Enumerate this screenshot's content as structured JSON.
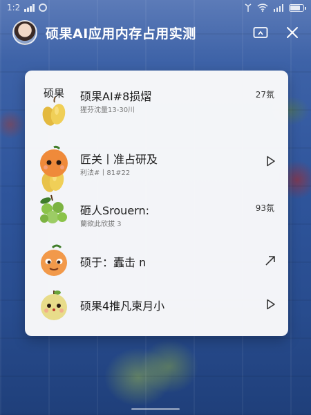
{
  "status_bar": {
    "time": "1:2",
    "signal_icon": "signal-icon",
    "wifi_icon": "wifi-icon",
    "battery_icon": "battery-icon"
  },
  "header": {
    "title": "硕果AI应用内存占用实测",
    "avatar_icon": "avatar",
    "cast_icon": "cast-icon",
    "close_icon": "close-icon"
  },
  "card": {
    "heading": "硕果",
    "items": [
      {
        "name": "硕果AI#8损熠",
        "sub": "猩芬沈量13-30川",
        "meta": "27氛",
        "icon": "pear-icon",
        "fruit_color": "#e8c24a"
      },
      {
        "name": "匠关丨准占研及",
        "sub": "利法#丨81#22",
        "meta": "",
        "icon": "orange-face-icon",
        "action_icon": "play-icon",
        "fruit_color": "#ef8a3a"
      },
      {
        "name": "砸人Srouern:",
        "sub": "蘭欲此欣拔 3",
        "meta": "93氛",
        "icon": "green-fruit-icon",
        "fruit_color": "#8bc34a"
      },
      {
        "name": "硕于：蠹击      n",
        "sub": "",
        "meta": "",
        "icon": "peach-face-icon",
        "action_icon": "arrow-icon",
        "fruit_color": "#f2994a"
      },
      {
        "name": "硕果4推凡柬月小",
        "sub": "",
        "meta": "",
        "icon": "pear-face-icon",
        "action_icon": "play-icon",
        "fruit_color": "#e8dc8a"
      }
    ]
  },
  "colors": {
    "background": "#2f559c",
    "card": "#fafafb",
    "text": "#1c1c1c"
  }
}
